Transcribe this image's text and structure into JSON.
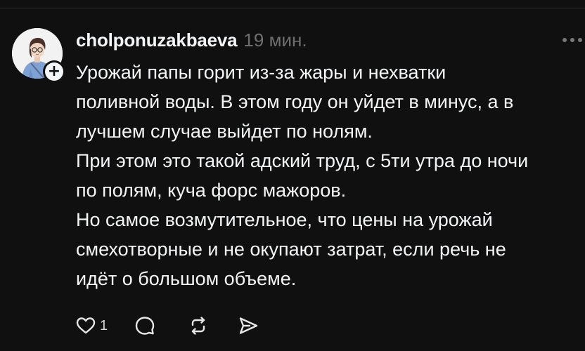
{
  "post": {
    "username": "cholponuzakbaeva",
    "timestamp": "19 мин.",
    "lines": [
      "Урожай папы горит из-за жары и нехватки",
      "поливной воды. В этом году он уйдет в минус, а в",
      "лучшем случае выйдет по нолям.",
      "При этом это такой адский труд, с 5ти утра до ночи",
      "по полям, куча форс мажоров.",
      "Но самое возмутительное, что цены на урожай",
      "смехотворные и не окупают затрат, если речь не",
      "идёт о большом объеме."
    ],
    "likes": "1",
    "follow_badge": "+"
  },
  "icons": {
    "avatar": "avatar-illustration",
    "follow": "plus-icon",
    "more": "more-dots-icon",
    "like": "heart-icon",
    "reply": "comment-icon",
    "repost": "repost-icon",
    "share": "send-icon"
  },
  "colors": {
    "background": "#101010",
    "text": "#f3f5f7",
    "muted": "#6f6f6f"
  }
}
